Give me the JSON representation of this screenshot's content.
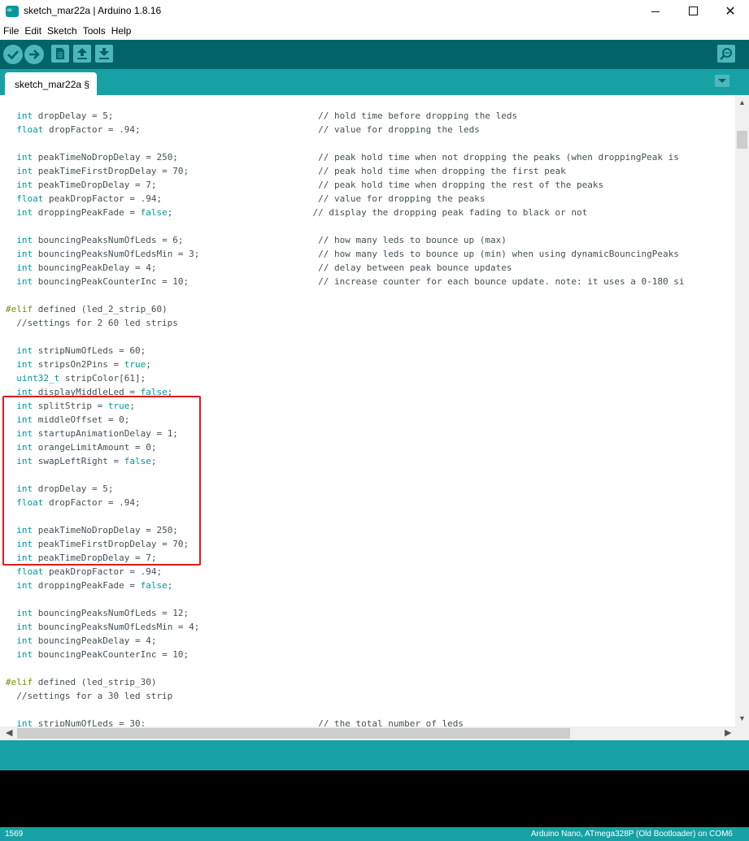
{
  "window": {
    "title": "sketch_mar22a | Arduino 1.8.16",
    "logo_text": "∞",
    "close_symbol": "✕"
  },
  "menu": [
    "File",
    "Edit",
    "Sketch",
    "Tools",
    "Help"
  ],
  "toolbar": {
    "buttons": [
      "verify-icon",
      "upload-icon",
      "new-icon",
      "open-icon",
      "save-icon"
    ],
    "serial_monitor": "serial-monitor-icon"
  },
  "tab": {
    "label": "sketch_mar22a §"
  },
  "colors": {
    "toolbar": "#006468",
    "tabbar": "#17a1a5",
    "keyword": "#00979c",
    "preprocessor": "#728e00",
    "highlight": "#e01b1b"
  },
  "code_lines": [
    [
      [
        "",
        "  "
      ],
      [
        "kw",
        "int"
      ],
      [
        "",
        " dropDelay = 5;                                      "
      ],
      [
        "cm",
        "// hold time before dropping the leds"
      ]
    ],
    [
      [
        "",
        "  "
      ],
      [
        "kw",
        "float"
      ],
      [
        "",
        " dropFactor = .94;                                 "
      ],
      [
        "cm",
        "// value for dropping the leds"
      ]
    ],
    [],
    [
      [
        "",
        "  "
      ],
      [
        "kw",
        "int"
      ],
      [
        "",
        " peakTimeNoDropDelay = 250;                          "
      ],
      [
        "cm",
        "// peak hold time when not dropping the peaks (when droppingPeak is"
      ]
    ],
    [
      [
        "",
        "  "
      ],
      [
        "kw",
        "int"
      ],
      [
        "",
        " peakTimeFirstDropDelay = 70;                        "
      ],
      [
        "cm",
        "// peak hold time when dropping the first peak"
      ]
    ],
    [
      [
        "",
        "  "
      ],
      [
        "kw",
        "int"
      ],
      [
        "",
        " peakTimeDropDelay = 7;                              "
      ],
      [
        "cm",
        "// peak hold time when dropping the rest of the peaks"
      ]
    ],
    [
      [
        "",
        "  "
      ],
      [
        "kw",
        "float"
      ],
      [
        "",
        " peakDropFactor = .94;                             "
      ],
      [
        "cm",
        "// value for dropping the peaks"
      ]
    ],
    [
      [
        "",
        "  "
      ],
      [
        "kw",
        "int"
      ],
      [
        "",
        " droppingPeakFade = "
      ],
      [
        "kw",
        "false"
      ],
      [
        "",
        ";                          "
      ],
      [
        "cm",
        "// display the dropping peak fading to black or not"
      ]
    ],
    [],
    [
      [
        "",
        "  "
      ],
      [
        "kw",
        "int"
      ],
      [
        "",
        " bouncingPeaksNumOfLeds = 6;                         "
      ],
      [
        "cm",
        "// how many leds to bounce up (max)"
      ]
    ],
    [
      [
        "",
        "  "
      ],
      [
        "kw",
        "int"
      ],
      [
        "",
        " bouncingPeaksNumOfLedsMin = 3;                      "
      ],
      [
        "cm",
        "// how many leds to bounce up (min) when using dynamicBouncingPeaks"
      ]
    ],
    [
      [
        "",
        "  "
      ],
      [
        "kw",
        "int"
      ],
      [
        "",
        " bouncingPeakDelay = 4;                              "
      ],
      [
        "cm",
        "// delay between peak bounce updates"
      ]
    ],
    [
      [
        "",
        "  "
      ],
      [
        "kw",
        "int"
      ],
      [
        "",
        " bouncingPeakCounterInc = 10;                        "
      ],
      [
        "cm",
        "// increase counter for each bounce update. note: it uses a 0-180 si"
      ]
    ],
    [],
    [
      [
        "pp",
        "#elif"
      ],
      [
        "",
        " defined (led_2_strip_60)"
      ]
    ],
    [
      [
        "cm",
        "  //settings for 2 60 led strips"
      ]
    ],
    [],
    [
      [
        "",
        "  "
      ],
      [
        "kw",
        "int"
      ],
      [
        "",
        " stripNumOfLeds = 60;"
      ]
    ],
    [
      [
        "",
        "  "
      ],
      [
        "kw",
        "int"
      ],
      [
        "",
        " stripsOn2Pins = "
      ],
      [
        "kw",
        "true"
      ],
      [
        "",
        ";"
      ]
    ],
    [
      [
        "",
        "  "
      ],
      [
        "kw",
        "uint32_t"
      ],
      [
        "",
        " stripColor[61];"
      ]
    ],
    [
      [
        "",
        "  "
      ],
      [
        "kw",
        "int"
      ],
      [
        "",
        " displayMiddleLed = "
      ],
      [
        "kw",
        "false"
      ],
      [
        "",
        ";"
      ]
    ],
    [
      [
        "",
        "  "
      ],
      [
        "kw",
        "int"
      ],
      [
        "",
        " splitStrip = "
      ],
      [
        "kw",
        "true"
      ],
      [
        "",
        ";"
      ]
    ],
    [
      [
        "",
        "  "
      ],
      [
        "kw",
        "int"
      ],
      [
        "",
        " middleOffset = 0;"
      ]
    ],
    [
      [
        "",
        "  "
      ],
      [
        "kw",
        "int"
      ],
      [
        "",
        " startupAnimationDelay = 1;"
      ]
    ],
    [
      [
        "",
        "  "
      ],
      [
        "kw",
        "int"
      ],
      [
        "",
        " orangeLimitAmount = 0;"
      ]
    ],
    [
      [
        "",
        "  "
      ],
      [
        "kw",
        "int"
      ],
      [
        "",
        " swapLeftRight = "
      ],
      [
        "kw",
        "false"
      ],
      [
        "",
        ";"
      ]
    ],
    [],
    [
      [
        "",
        "  "
      ],
      [
        "kw",
        "int"
      ],
      [
        "",
        " dropDelay = 5;"
      ]
    ],
    [
      [
        "",
        "  "
      ],
      [
        "kw",
        "float"
      ],
      [
        "",
        " dropFactor = .94;"
      ]
    ],
    [],
    [
      [
        "",
        "  "
      ],
      [
        "kw",
        "int"
      ],
      [
        "",
        " peakTimeNoDropDelay = 250;"
      ]
    ],
    [
      [
        "",
        "  "
      ],
      [
        "kw",
        "int"
      ],
      [
        "",
        " peakTimeFirstDropDelay = 70;"
      ]
    ],
    [
      [
        "",
        "  "
      ],
      [
        "kw",
        "int"
      ],
      [
        "",
        " peakTimeDropDelay = 7;"
      ]
    ],
    [
      [
        "",
        "  "
      ],
      [
        "kw",
        "float"
      ],
      [
        "",
        " peakDropFactor = .94;"
      ]
    ],
    [
      [
        "",
        "  "
      ],
      [
        "kw",
        "int"
      ],
      [
        "",
        " droppingPeakFade = "
      ],
      [
        "kw",
        "false"
      ],
      [
        "",
        ";"
      ]
    ],
    [],
    [
      [
        "",
        "  "
      ],
      [
        "kw",
        "int"
      ],
      [
        "",
        " bouncingPeaksNumOfLeds = 12;"
      ]
    ],
    [
      [
        "",
        "  "
      ],
      [
        "kw",
        "int"
      ],
      [
        "",
        " bouncingPeaksNumOfLedsMin = 4;"
      ]
    ],
    [
      [
        "",
        "  "
      ],
      [
        "kw",
        "int"
      ],
      [
        "",
        " bouncingPeakDelay = 4;"
      ]
    ],
    [
      [
        "",
        "  "
      ],
      [
        "kw",
        "int"
      ],
      [
        "",
        " bouncingPeakCounterInc = 10;"
      ]
    ],
    [],
    [
      [
        "pp",
        "#elif"
      ],
      [
        "",
        " defined (led_strip_30)"
      ]
    ],
    [
      [
        "cm",
        "  //settings for a 30 led strip"
      ]
    ],
    [],
    [
      [
        "",
        "  "
      ],
      [
        "kw",
        "int"
      ],
      [
        "",
        " stripNumOfLeds = 30;                                "
      ],
      [
        "cm",
        "// the total number of leds"
      ]
    ]
  ],
  "status": {
    "line_number": "1569",
    "board": "Arduino Nano, ATmega328P (Old Bootloader) on COM6"
  }
}
